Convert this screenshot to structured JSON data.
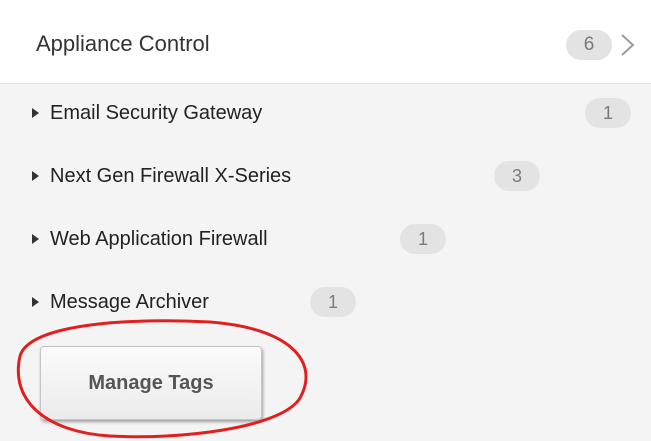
{
  "panel": {
    "title": "Appliance Control",
    "count": "6",
    "chevron_icon": "chevron-right-icon"
  },
  "tree": {
    "expand_icon": "triangle-right-icon",
    "items": [
      {
        "label": "Email Security Gateway",
        "count": "1"
      },
      {
        "label": "Next Gen Firewall X-Series",
        "count": "3"
      },
      {
        "label": "Web Application Firewall",
        "count": "1"
      },
      {
        "label": "Message Archiver",
        "count": "1"
      }
    ]
  },
  "actions": {
    "manage_tags_label": "Manage Tags"
  },
  "colors": {
    "highlight": "#e0201e",
    "badge_bg": "#e3e3e3",
    "badge_text": "#7a7a7a",
    "panel_bg": "#f4f4f4"
  }
}
